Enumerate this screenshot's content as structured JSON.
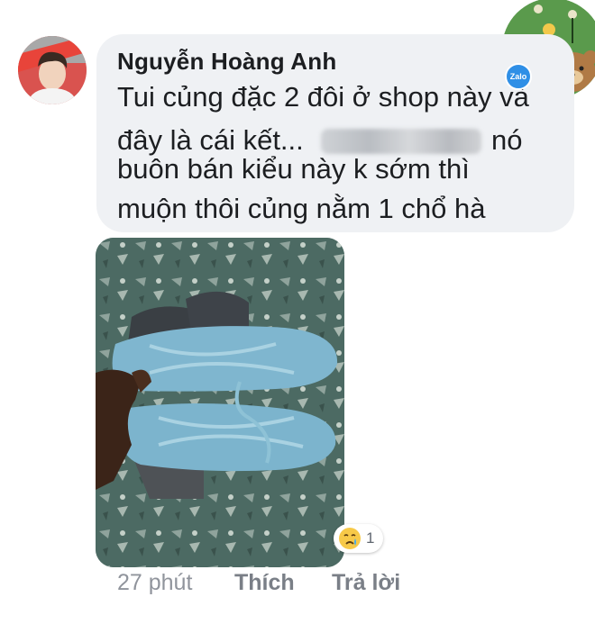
{
  "comment": {
    "author": "Nguyễn Hoàng Anh",
    "lines": [
      "Tui củng đặc 2 đôi ở shop này và",
      "đây là cái kết...",
      "nó",
      "buôn bán kiểu này k sớm thì",
      "muộn thôi củng nằm 1 chổ hà"
    ]
  },
  "reaction": {
    "icon": "crying-face-icon",
    "count": "1"
  },
  "footer": {
    "time": "27 phút",
    "like": "Thích",
    "reply": "Trả lời"
  },
  "badge": {
    "label": "Zalo"
  },
  "colors": {
    "bubble": "#eff1f4",
    "text": "#1c1e21",
    "meta": "#90949c",
    "zalo": "#2f8fe6"
  }
}
